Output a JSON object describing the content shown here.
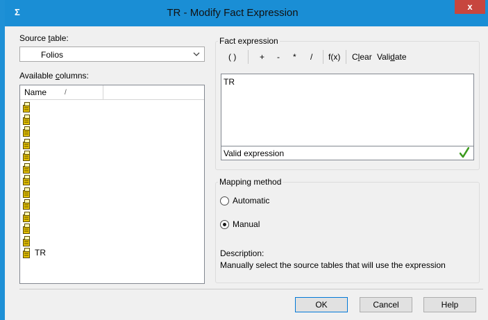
{
  "window": {
    "title": "TR - Modify Fact Expression",
    "app_icon": "Σ",
    "close_label": "x"
  },
  "source_table": {
    "label_pre": "Source ",
    "label_accel": "t",
    "label_post": "able:",
    "value": "Folios"
  },
  "available_columns": {
    "label_pre": "Available ",
    "label_accel": "c",
    "label_post": "olumns:",
    "header_name": "Name",
    "sort_indicator": "/",
    "rows": [
      "",
      "",
      "",
      "",
      "",
      "",
      "",
      "",
      "",
      "",
      "",
      "",
      "TR"
    ]
  },
  "fact_expression": {
    "group_label": "Fact expression",
    "toolbar": {
      "parens": "( )",
      "plus": "+",
      "minus": "-",
      "multiply": "*",
      "divide": "/",
      "function": "f(x)",
      "clear_pre": "C",
      "clear_accel": "l",
      "clear_post": "ear",
      "validate_pre": "Vali",
      "validate_accel": "d",
      "validate_post": "ate"
    },
    "text": "TR",
    "status": "Valid expression"
  },
  "mapping_method": {
    "group_label": "Mapping method",
    "options": [
      {
        "label": "Automatic",
        "selected": false
      },
      {
        "label": "Manual",
        "selected": true
      }
    ],
    "description_label": "Description:",
    "description_text": "Manually select the source tables that will use the expression"
  },
  "buttons": {
    "ok": "OK",
    "cancel": "Cancel",
    "help": "Help"
  },
  "colors": {
    "title_bar": "#1a8ed5",
    "close_button": "#c7463e",
    "check_mark": "#3c9a1e",
    "column_icon": "#e6c200"
  }
}
